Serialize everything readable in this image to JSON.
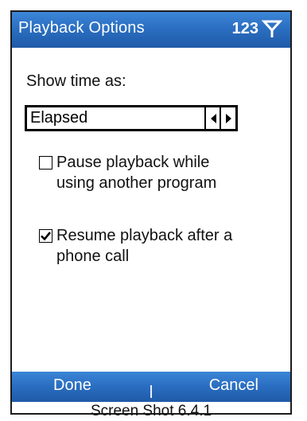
{
  "window": {
    "title": "Playback Options",
    "status_number": "123",
    "signal_icon": "antenna-signal-icon"
  },
  "form": {
    "show_time_label": "Show time as:",
    "show_time_value": "Elapsed",
    "options": [
      {
        "label_line1": "Pause playback while",
        "label_line2": "using another program",
        "checked": false
      },
      {
        "label_line1": "Resume playback after a",
        "label_line2": "phone call",
        "checked": true
      }
    ]
  },
  "softkeys": {
    "left": "Done",
    "right": "Cancel"
  },
  "caption": "Screen Shot 6.4.1",
  "colors": {
    "titlebar": "#2b6fc2",
    "softkeys": "#2b6fc2",
    "border": "#1c1c1c"
  }
}
